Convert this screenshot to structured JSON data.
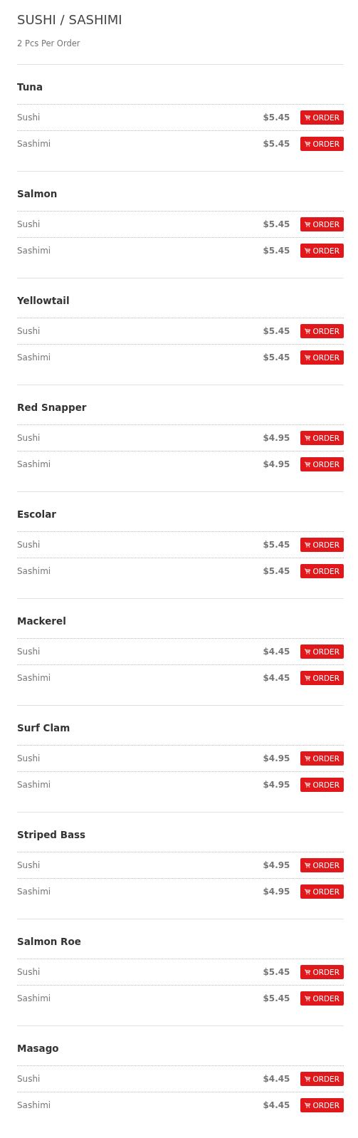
{
  "title": "SUSHI / SASHIMI",
  "subtitle": "2 Pcs Per Order",
  "items": [
    {
      "name": "Tuna",
      "options": [
        {
          "label": "Sushi",
          "price": "$5.45",
          "button": "ORDER"
        },
        {
          "label": "Sashimi",
          "price": "$5.45",
          "button": "ORDER"
        }
      ]
    },
    {
      "name": "Salmon",
      "options": [
        {
          "label": "Sushi",
          "price": "$5.45",
          "button": "ORDER"
        },
        {
          "label": "Sashimi",
          "price": "$5.45",
          "button": "ORDER"
        }
      ]
    },
    {
      "name": "Yellowtail",
      "options": [
        {
          "label": "Sushi",
          "price": "$5.45",
          "button": "ORDER"
        },
        {
          "label": "Sashimi",
          "price": "$5.45",
          "button": "ORDER"
        }
      ]
    },
    {
      "name": "Red Snapper",
      "options": [
        {
          "label": "Sushi",
          "price": "$4.95",
          "button": "ORDER"
        },
        {
          "label": "Sashimi",
          "price": "$4.95",
          "button": "ORDER"
        }
      ]
    },
    {
      "name": "Escolar",
      "options": [
        {
          "label": "Sushi",
          "price": "$5.45",
          "button": "ORDER"
        },
        {
          "label": "Sashimi",
          "price": "$5.45",
          "button": "ORDER"
        }
      ]
    },
    {
      "name": "Mackerel",
      "options": [
        {
          "label": "Sushi",
          "price": "$4.45",
          "button": "ORDER"
        },
        {
          "label": "Sashimi",
          "price": "$4.45",
          "button": "ORDER"
        }
      ]
    },
    {
      "name": "Surf Clam",
      "options": [
        {
          "label": "Sushi",
          "price": "$4.95",
          "button": "ORDER"
        },
        {
          "label": "Sashimi",
          "price": "$4.95",
          "button": "ORDER"
        }
      ]
    },
    {
      "name": "Striped Bass",
      "options": [
        {
          "label": "Sushi",
          "price": "$4.95",
          "button": "ORDER"
        },
        {
          "label": "Sashimi",
          "price": "$4.95",
          "button": "ORDER"
        }
      ]
    },
    {
      "name": "Salmon Roe",
      "options": [
        {
          "label": "Sushi",
          "price": "$5.45",
          "button": "ORDER"
        },
        {
          "label": "Sashimi",
          "price": "$5.45",
          "button": "ORDER"
        }
      ]
    },
    {
      "name": "Masago",
      "options": [
        {
          "label": "Sushi",
          "price": "$4.45",
          "button": "ORDER"
        },
        {
          "label": "Sashimi",
          "price": "$4.45",
          "button": "ORDER"
        }
      ]
    }
  ]
}
